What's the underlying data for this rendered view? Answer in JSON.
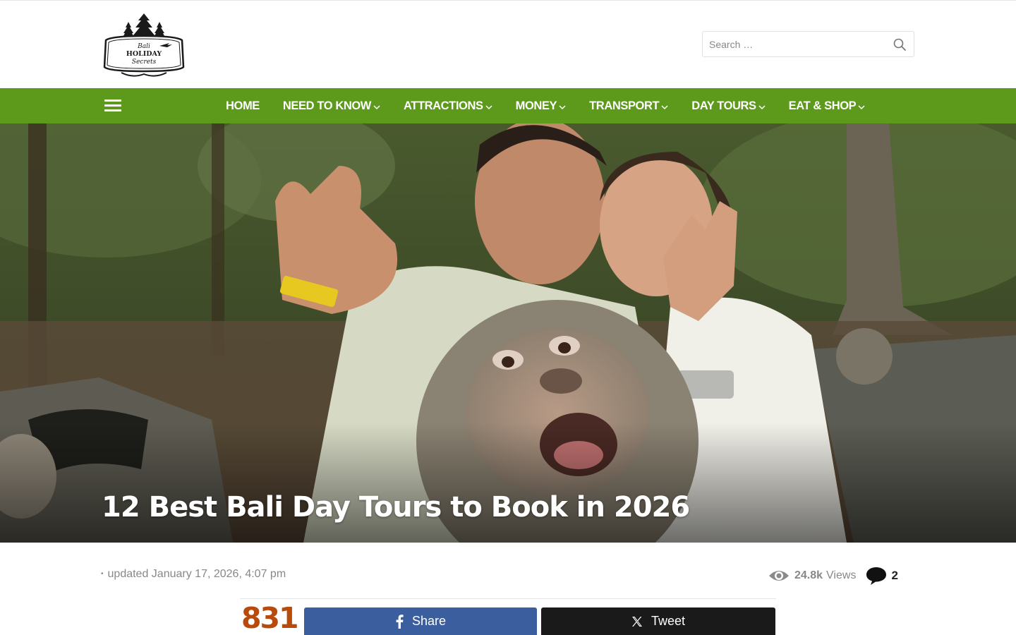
{
  "header": {
    "logo_text": [
      "Bali",
      "HOLIDAY",
      "Secrets"
    ],
    "search_placeholder": "Search …"
  },
  "nav": {
    "items": [
      {
        "label": "HOME",
        "has_dropdown": false
      },
      {
        "label": "NEED TO KNOW",
        "has_dropdown": true
      },
      {
        "label": "ATTRACTIONS",
        "has_dropdown": true
      },
      {
        "label": "MONEY",
        "has_dropdown": true
      },
      {
        "label": "TRANSPORT",
        "has_dropdown": true
      },
      {
        "label": "DAY TOURS",
        "has_dropdown": true
      },
      {
        "label": "EAT & SHOP",
        "has_dropdown": true
      }
    ]
  },
  "hero": {
    "title": "12 Best Bali Day Tours to Book in 2026"
  },
  "meta": {
    "updated": "updated January 17, 2026, 4:07 pm",
    "views_count": "24.8k",
    "views_label": "Views",
    "comments_count": "2"
  },
  "share": {
    "count": "831",
    "facebook_label": "Share",
    "x_label": "Tweet"
  },
  "colors": {
    "nav_bg": "#5d9a1c",
    "share_count": "#b84a0c",
    "facebook": "#3b5e9f",
    "x": "#1a1a1a"
  }
}
